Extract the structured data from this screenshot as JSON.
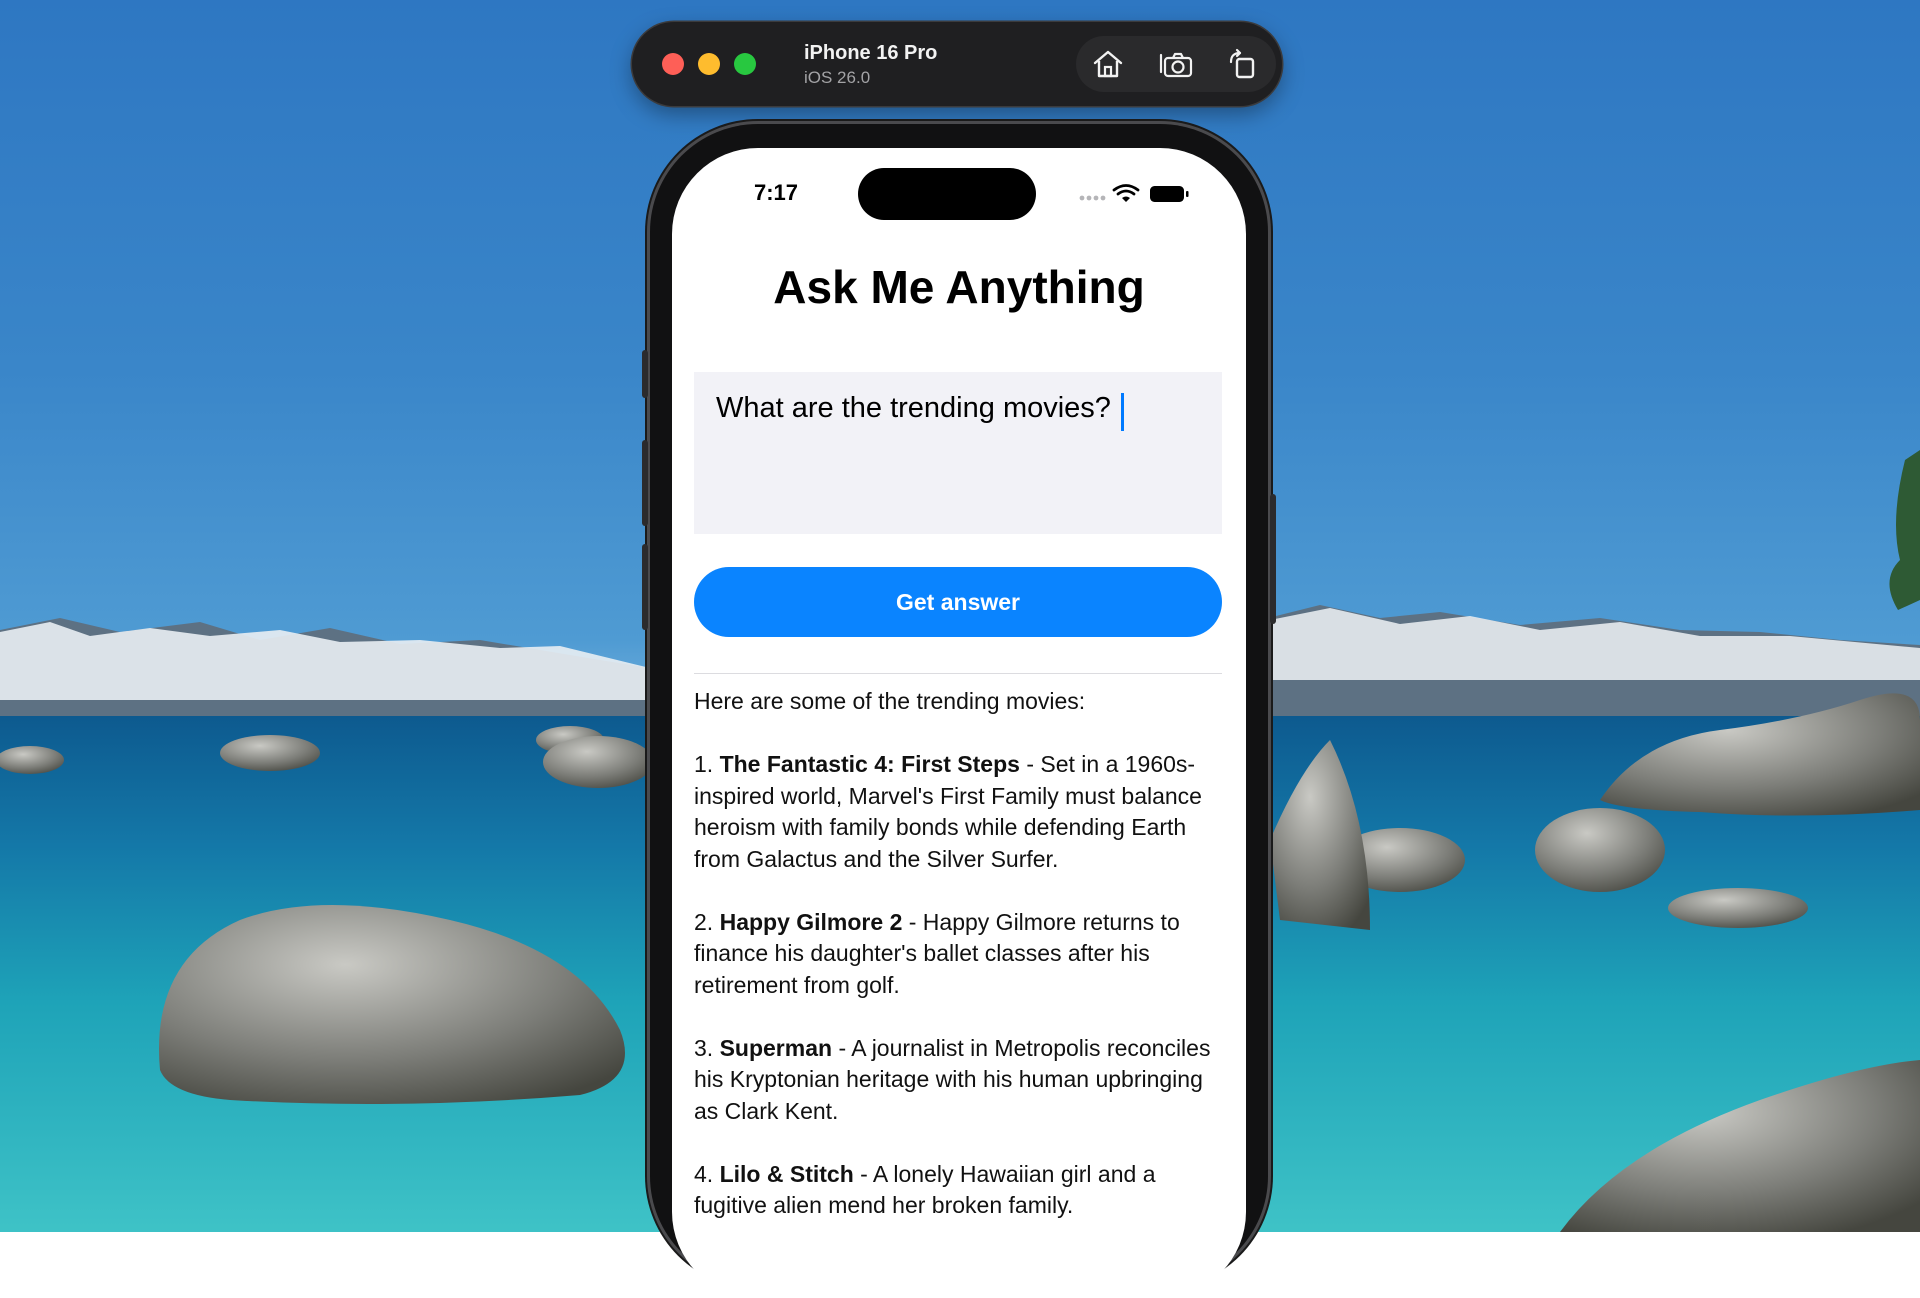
{
  "simulator": {
    "device_name": "iPhone 16 Pro",
    "os_version": "iOS 26.0",
    "tools": [
      "home-icon",
      "screenshot-icon",
      "rotate-icon"
    ]
  },
  "status_bar": {
    "time": "7:17"
  },
  "app": {
    "title": "Ask Me Anything",
    "question_value": "What are the trending movies?",
    "button_label": "Get answer",
    "accent_color": "#0a84ff",
    "answer_intro": "Here are some of the trending movies:",
    "movies": [
      {
        "number": "1.",
        "title": "The Fantastic 4: First Steps",
        "description": "- Set in a 1960s-inspired world, Marvel's First Family must balance heroism with family bonds while defending Earth from Galactus and the Silver Surfer."
      },
      {
        "number": "2.",
        "title": "Happy Gilmore 2",
        "description": "- Happy Gilmore returns to finance his daughter's ballet classes after his retirement from golf."
      },
      {
        "number": "3.",
        "title": "Superman",
        "description": "- A journalist in Metropolis reconciles his Kryptonian heritage with his human upbringing as Clark Kent."
      },
      {
        "number": "4.",
        "title": "Lilo & Stitch",
        "description": "- A lonely Hawaiian girl and a fugitive alien mend her broken family."
      }
    ]
  }
}
